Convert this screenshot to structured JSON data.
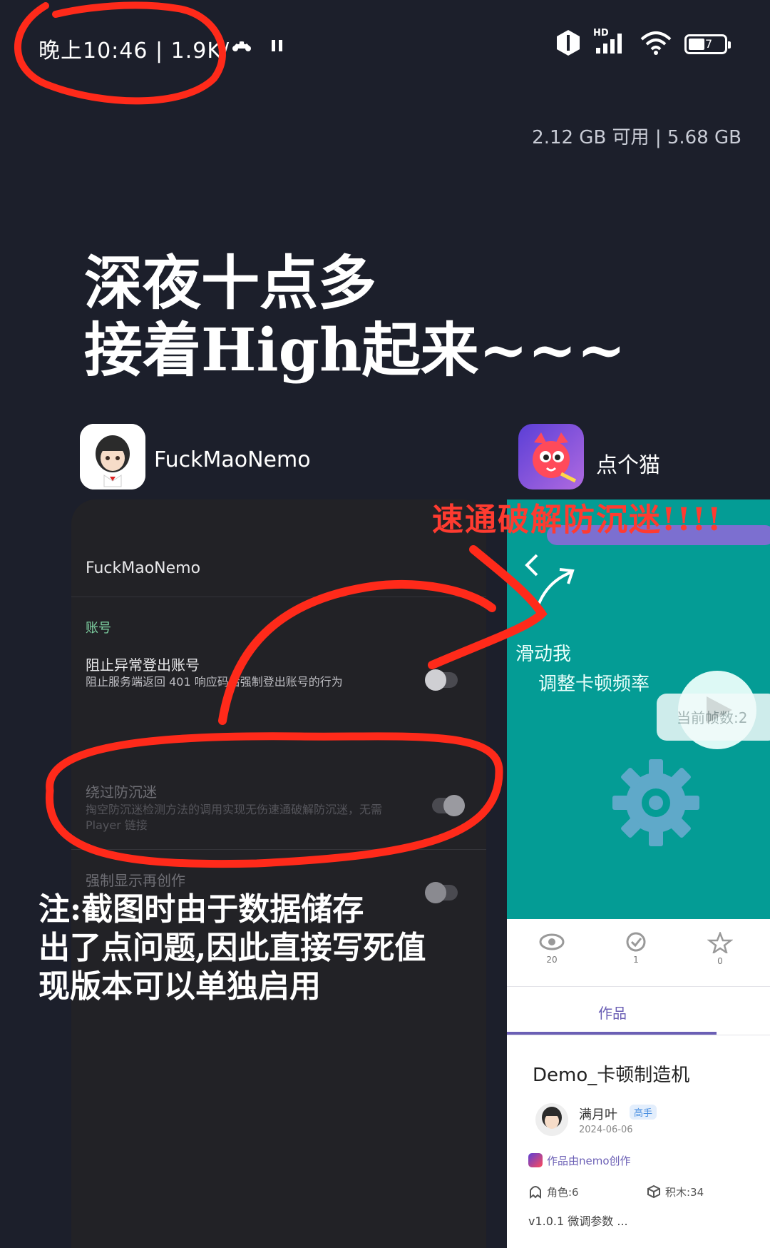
{
  "status_bar": {
    "time_speed": "晚上10:46 | 1.9K/",
    "battery_level": "7",
    "hd_label": "HD"
  },
  "memory": "2.12 GB 可用 | 5.68 GB",
  "caption": {
    "line1": "深夜十点多",
    "line2": "接着High起来~~~"
  },
  "apps": {
    "left": {
      "name": "FuckMaoNemo"
    },
    "right": {
      "name": "点个猫"
    }
  },
  "left_card": {
    "title": "FuckMaoNemo",
    "section_account": "账号",
    "item1_title": "阻止异常登出账号",
    "item1_desc": "阻止服务端返回 401 响应码后强制登出账号的行为",
    "section2_partial": "...",
    "item2_title": "绕过防沉迷",
    "item2_desc": "掏空防沉迷检测方法的调用实现无伤速通破解防沉迷，无需 Player 链接",
    "item3_title": "强制显示再创作"
  },
  "right_card": {
    "teal_hint_line1": "滑动我",
    "teal_hint_line2": "调整卡顿频率",
    "bubble_text": "当前帧数:2",
    "stats": [
      {
        "icon": "eye-icon",
        "value": "20"
      },
      {
        "icon": "like-icon",
        "value": "1"
      },
      {
        "icon": "star-icon",
        "value": "0"
      }
    ],
    "tab_works": "作品",
    "work_title": "Demo_卡顿制造机",
    "author_name": "满月叶",
    "author_badge": "高手",
    "date": "2024-06-06",
    "created_by": "作品由nemo创作",
    "roles": "角色:6",
    "blocks": "积木:34",
    "version": "v1.0.1 微调参数 ..."
  },
  "annotations": {
    "red_title": "速通破解防沉迷!!!!",
    "note_line1": "注:截图时由于数据储存",
    "note_line2": "出了点问题,因此直接写死值",
    "note_line3": "现版本可以单独启用"
  },
  "colors": {
    "background": "#1c1f2b",
    "teal": "#049c95",
    "annotation_red": "#ff3b30",
    "accent_green": "#7fd3a3",
    "tab_purple": "#6b5fb5"
  }
}
